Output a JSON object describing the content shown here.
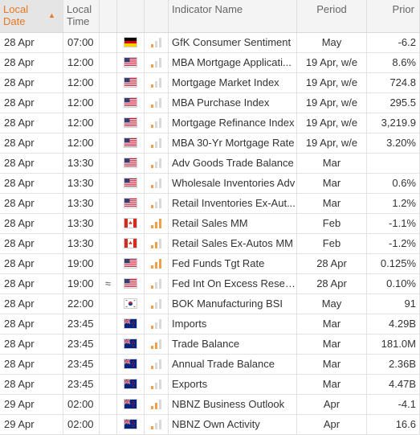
{
  "header": {
    "local_date": "Local Date",
    "local_time": "Local Time",
    "indicator_name": "Indicator Name",
    "period": "Period",
    "prior": "Prior"
  },
  "colors": {
    "accent": "#e87722",
    "importance_on": "#f0a04b",
    "importance_off": "#d9d9d9"
  },
  "rows": [
    {
      "date": "28 Apr",
      "time": "07:00",
      "symbol": "",
      "country": "de",
      "importance": 1,
      "name": "GfK Consumer Sentiment",
      "period": "May",
      "prior": "-6.2"
    },
    {
      "date": "28 Apr",
      "time": "12:00",
      "symbol": "",
      "country": "us",
      "importance": 1,
      "name": "MBA Mortgage Applicati...",
      "period": "19 Apr, w/e",
      "prior": "8.6%"
    },
    {
      "date": "28 Apr",
      "time": "12:00",
      "symbol": "",
      "country": "us",
      "importance": 1,
      "name": "Mortgage Market Index",
      "period": "19 Apr, w/e",
      "prior": "724.8"
    },
    {
      "date": "28 Apr",
      "time": "12:00",
      "symbol": "",
      "country": "us",
      "importance": 1,
      "name": "MBA Purchase Index",
      "period": "19 Apr, w/e",
      "prior": "295.5"
    },
    {
      "date": "28 Apr",
      "time": "12:00",
      "symbol": "",
      "country": "us",
      "importance": 1,
      "name": "Mortgage Refinance Index",
      "period": "19 Apr, w/e",
      "prior": "3,219.9"
    },
    {
      "date": "28 Apr",
      "time": "12:00",
      "symbol": "",
      "country": "us",
      "importance": 1,
      "name": "MBA 30-Yr Mortgage Rate",
      "period": "19 Apr, w/e",
      "prior": "3.20%"
    },
    {
      "date": "28 Apr",
      "time": "13:30",
      "symbol": "",
      "country": "us",
      "importance": 1,
      "name": "Adv Goods Trade Balance",
      "period": "Mar",
      "prior": ""
    },
    {
      "date": "28 Apr",
      "time": "13:30",
      "symbol": "",
      "country": "us",
      "importance": 1,
      "name": "Wholesale Inventories Adv",
      "period": "Mar",
      "prior": "0.6%"
    },
    {
      "date": "28 Apr",
      "time": "13:30",
      "symbol": "",
      "country": "us",
      "importance": 1,
      "name": "Retail Inventories Ex-Aut...",
      "period": "Mar",
      "prior": "1.2%"
    },
    {
      "date": "28 Apr",
      "time": "13:30",
      "symbol": "",
      "country": "ca",
      "importance": 3,
      "name": "Retail Sales MM",
      "period": "Feb",
      "prior": "-1.1%"
    },
    {
      "date": "28 Apr",
      "time": "13:30",
      "symbol": "",
      "country": "ca",
      "importance": 2,
      "name": "Retail Sales Ex-Autos MM",
      "period": "Feb",
      "prior": "-1.2%"
    },
    {
      "date": "28 Apr",
      "time": "19:00",
      "symbol": "",
      "country": "us",
      "importance": 3,
      "name": "Fed Funds Tgt Rate",
      "period": "28 Apr",
      "prior": "0.125%"
    },
    {
      "date": "28 Apr",
      "time": "19:00",
      "symbol": "≈",
      "country": "us",
      "importance": 1,
      "name": "Fed Int On Excess Reser...",
      "period": "28 Apr",
      "prior": "0.10%"
    },
    {
      "date": "28 Apr",
      "time": "22:00",
      "symbol": "",
      "country": "kr",
      "importance": 1,
      "name": "BOK Manufacturing BSI",
      "period": "May",
      "prior": "91"
    },
    {
      "date": "28 Apr",
      "time": "23:45",
      "symbol": "",
      "country": "nz",
      "importance": 1,
      "name": "Imports",
      "period": "Mar",
      "prior": "4.29B"
    },
    {
      "date": "28 Apr",
      "time": "23:45",
      "symbol": "",
      "country": "nz",
      "importance": 2,
      "name": "Trade Balance",
      "period": "Mar",
      "prior": "181.0M"
    },
    {
      "date": "28 Apr",
      "time": "23:45",
      "symbol": "",
      "country": "nz",
      "importance": 1,
      "name": "Annual Trade Balance",
      "period": "Mar",
      "prior": "2.36B"
    },
    {
      "date": "28 Apr",
      "time": "23:45",
      "symbol": "",
      "country": "nz",
      "importance": 1,
      "name": "Exports",
      "period": "Mar",
      "prior": "4.47B"
    },
    {
      "date": "29 Apr",
      "time": "02:00",
      "symbol": "",
      "country": "nz",
      "importance": 2,
      "name": "NBNZ Business Outlook",
      "period": "Apr",
      "prior": "-4.1"
    },
    {
      "date": "29 Apr",
      "time": "02:00",
      "symbol": "",
      "country": "nz",
      "importance": 1,
      "name": "NBNZ Own Activity",
      "period": "Apr",
      "prior": "16.6"
    }
  ]
}
